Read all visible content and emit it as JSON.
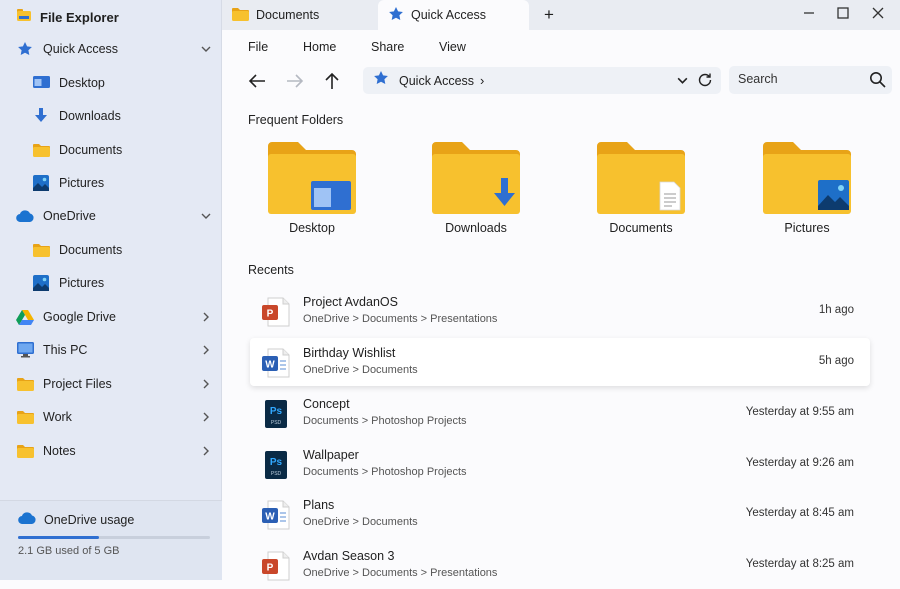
{
  "sidebar": {
    "title": "File Explorer",
    "items": [
      {
        "label": "Quick Access",
        "icon": "star-icon",
        "chevron": "down"
      },
      {
        "label": "Desktop",
        "icon": "desktop-icon"
      },
      {
        "label": "Downloads",
        "icon": "download-arrow-icon"
      },
      {
        "label": "Documents",
        "icon": "folder-icon"
      },
      {
        "label": "Pictures",
        "icon": "pictures-icon"
      },
      {
        "label": "OneDrive",
        "icon": "cloud-icon",
        "chevron": "down"
      },
      {
        "label": "Documents",
        "icon": "folder-icon"
      },
      {
        "label": "Pictures",
        "icon": "pictures-icon"
      },
      {
        "label": "Google Drive",
        "icon": "google-drive-icon",
        "chevron": "right"
      },
      {
        "label": "This PC",
        "icon": "monitor-icon",
        "chevron": "right"
      },
      {
        "label": "Project Files",
        "icon": "folder-icon",
        "chevron": "right"
      },
      {
        "label": "Work",
        "icon": "folder-icon",
        "chevron": "right"
      },
      {
        "label": "Notes",
        "icon": "folder-icon",
        "chevron": "right"
      }
    ],
    "usage": {
      "title": "OneDrive usage",
      "text": "2.1 GB used of 5 GB",
      "fraction": 0.42
    }
  },
  "tabs": [
    {
      "label": "Documents",
      "icon": "folder-icon"
    },
    {
      "label": "Quick Access",
      "icon": "star-icon"
    }
  ],
  "tab_add_label": "+",
  "menu": {
    "file": "File",
    "home": "Home",
    "share": "Share",
    "view": "View"
  },
  "address": {
    "label": "Quick Access",
    "sep": "›"
  },
  "search": {
    "placeholder": "Search"
  },
  "frequent": {
    "title": "Frequent Folders",
    "folders": [
      {
        "label": "Desktop",
        "badge": "desktop"
      },
      {
        "label": "Downloads",
        "badge": "download"
      },
      {
        "label": "Documents",
        "badge": "document"
      },
      {
        "label": "Pictures",
        "badge": "picture"
      }
    ]
  },
  "recents": {
    "title": "Recents",
    "items": [
      {
        "name": "Project AvdanOS",
        "path": "OneDrive > Documents > Presentations",
        "time": "1h ago",
        "type": "powerpoint"
      },
      {
        "name": "Birthday Wishlist",
        "path": "OneDrive > Documents",
        "time": "5h ago",
        "type": "word"
      },
      {
        "name": "Concept",
        "path": "Documents > Photoshop Projects",
        "time": "Yesterday at 9:55 am",
        "type": "photoshop"
      },
      {
        "name": "Wallpaper",
        "path": "Documents > Photoshop Projects",
        "time": "Yesterday at 9:26 am",
        "type": "photoshop"
      },
      {
        "name": "Plans",
        "path": "OneDrive > Documents",
        "time": "Yesterday at 8:45 am",
        "type": "word"
      },
      {
        "name": "Avdan Season 3",
        "path": "OneDrive > Documents > Presentations",
        "time": "Yesterday at 8:25 am",
        "type": "powerpoint"
      }
    ]
  },
  "colors": {
    "accent": "#2f6fd1",
    "folder": "#f7c12e",
    "folder_tab": "#e8a317",
    "word": "#2b5fb4",
    "powerpoint": "#c9472a",
    "photoshop": "#0a2a45"
  }
}
